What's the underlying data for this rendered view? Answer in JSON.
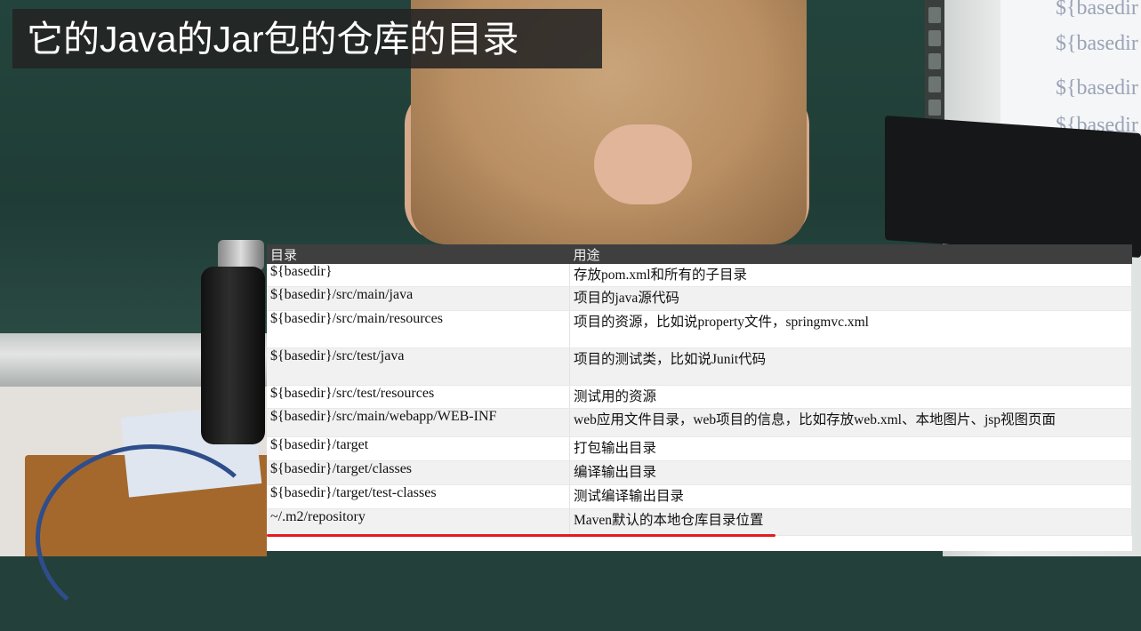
{
  "caption": {
    "text": "它的Java的Jar包的仓库的目录"
  },
  "projector": {
    "ghost_lines": [
      "${basedir",
      "${basedir",
      "${basedir",
      "${basedir"
    ]
  },
  "table": {
    "headers": [
      "目录",
      "用途"
    ],
    "rows": [
      {
        "dir": "${basedir}",
        "use": "存放pom.xml和所有的子目录"
      },
      {
        "dir": "${basedir}/src/main/java",
        "use": "项目的java源代码"
      },
      {
        "dir": "${basedir}/src/main/resources",
        "use": "项目的资源，比如说property文件，springmvc.xml"
      },
      {
        "dir": "${basedir}/src/test/java",
        "use": "项目的测试类，比如说Junit代码"
      },
      {
        "dir": "${basedir}/src/test/resources",
        "use": "测试用的资源"
      },
      {
        "dir": "${basedir}/src/main/webapp/WEB-INF",
        "use": "web应用文件目录，web项目的信息，比如存放web.xml、本地图片、jsp视图页面"
      },
      {
        "dir": "${basedir}/target",
        "use": "打包输出目录"
      },
      {
        "dir": "${basedir}/target/classes",
        "use": "编译输出目录"
      },
      {
        "dir": "${basedir}/target/test-classes",
        "use": "测试编译输出目录"
      },
      {
        "dir": "~/.m2/repository",
        "use": "Maven默认的本地仓库目录位置"
      }
    ],
    "highlight_color": "#e5191e"
  }
}
